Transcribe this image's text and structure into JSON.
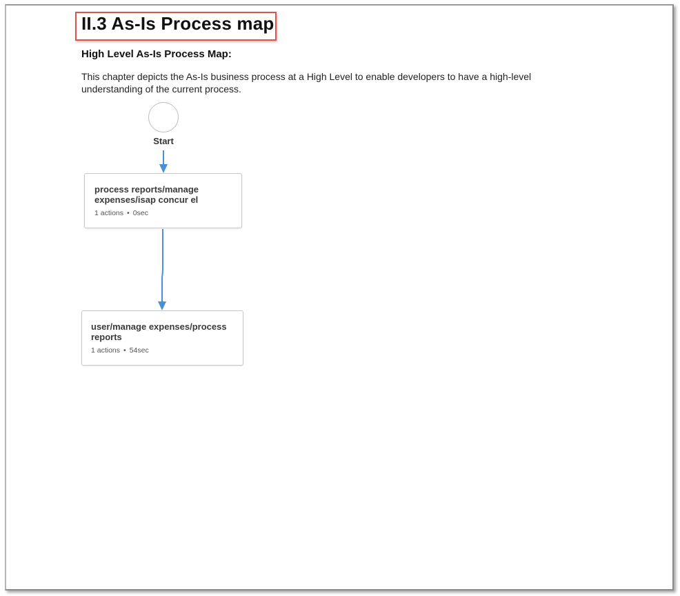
{
  "section": {
    "heading": "II.3 As-Is Process map",
    "subheading": "High Level As-Is Process Map:",
    "description": "This chapter depicts the As-Is business process at a High Level to enable developers to have a high-level understanding of the current process."
  },
  "process_map": {
    "start_label": "Start",
    "arrow_color": "#4a90d9",
    "nodes": [
      {
        "title": "process reports/manage expenses/isap concur el",
        "actions": "1 actions",
        "separator": "•",
        "duration": "0sec"
      },
      {
        "title": "user/manage expenses/process reports",
        "actions": "1 actions",
        "separator": "•",
        "duration": "54sec"
      }
    ]
  },
  "colors": {
    "heading_highlight": "#d9534f"
  }
}
